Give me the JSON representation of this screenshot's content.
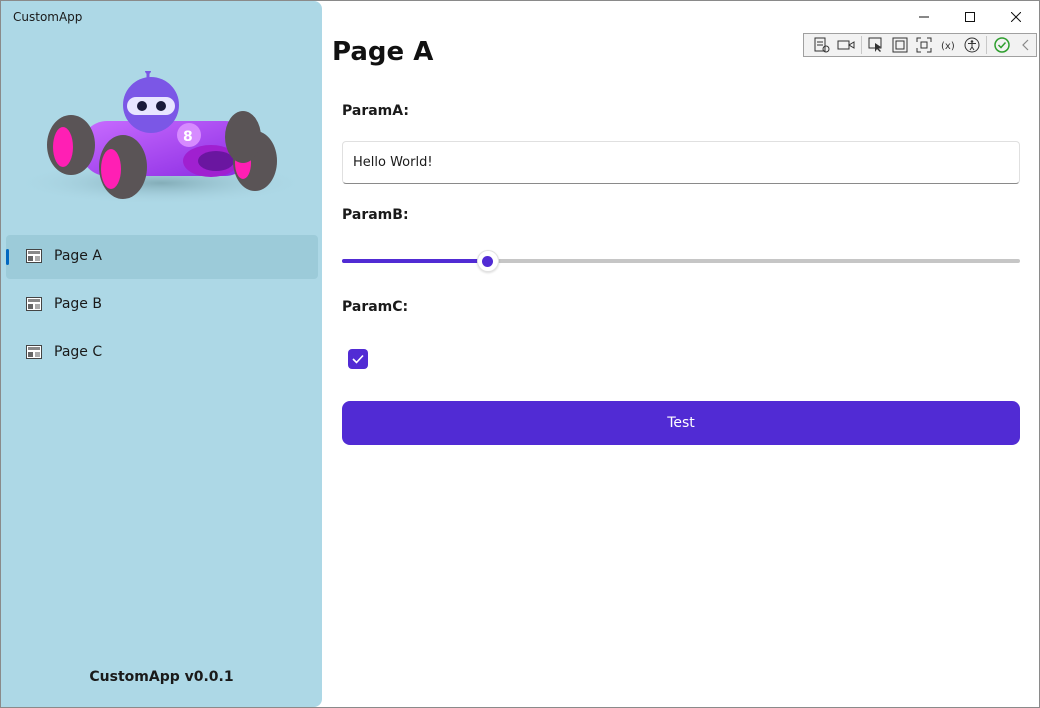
{
  "window": {
    "title": "CustomApp"
  },
  "sidebar": {
    "logo_icon": "race-car-bot-logo",
    "items": [
      {
        "label": "Page A",
        "icon": "image-icon",
        "selected": true
      },
      {
        "label": "Page B",
        "icon": "image-icon",
        "selected": false
      },
      {
        "label": "Page C",
        "icon": "image-icon",
        "selected": false
      }
    ],
    "footer": "CustomApp v0.0.1"
  },
  "debug_toolbar": {
    "tools": [
      "live-visual-tree-icon",
      "record-icon",
      "select-element-icon",
      "display-layout-adorners-icon",
      "track-focus-icon",
      "binding-failures-icon",
      "accessibility-icon",
      "hot-reload-ok-icon",
      "collapse-chevron-icon"
    ]
  },
  "main": {
    "title": "Page A",
    "param_a": {
      "label": "ParamA:",
      "value": "Hello World!"
    },
    "param_b": {
      "label": "ParamB:",
      "value": 0.215
    },
    "param_c": {
      "label": "ParamC:",
      "checked": true
    },
    "test_button": {
      "label": "Test"
    }
  },
  "colors": {
    "accent": "#512bd4",
    "sidebar_bg": "#add8e6",
    "selection_indicator": "#0067c0"
  }
}
